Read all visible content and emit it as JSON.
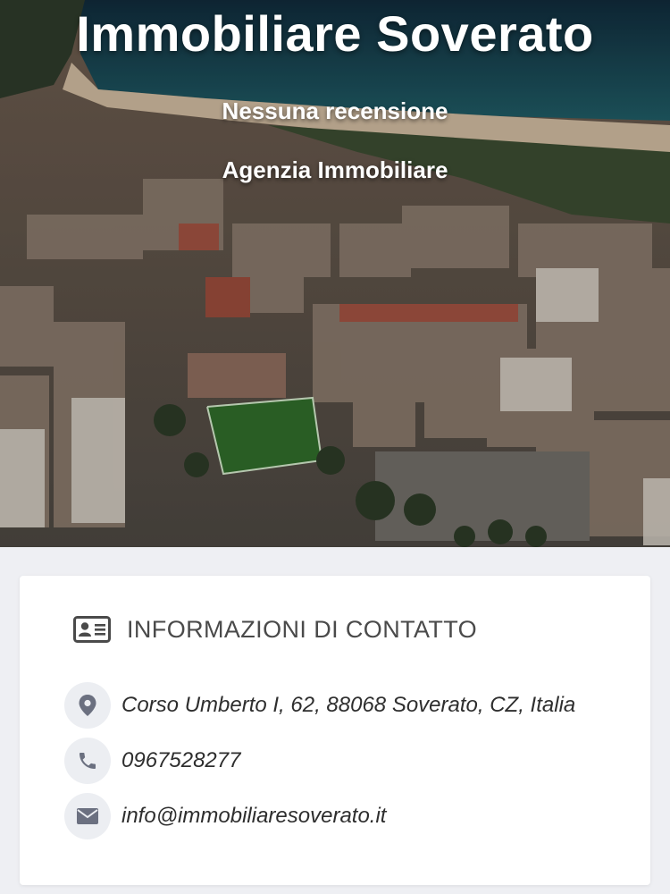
{
  "hero": {
    "title": "Immobiliare Soverato",
    "reviews": "Nessuna recensione",
    "category": "Agenzia Immobiliare"
  },
  "contact": {
    "heading": "INFORMAZIONI DI CONTATTO",
    "address": "Corso Umberto I, 62, 88068 Soverato, CZ, Italia",
    "phone": "0967528277",
    "email": "info@immobiliaresoverato.it"
  },
  "icons": {
    "heading": "id-card-icon",
    "address": "map-marker-icon",
    "phone": "phone-icon",
    "email": "envelope-icon"
  },
  "colors": {
    "icon": "#6b7080",
    "icon_background": "#eceef2",
    "page_background": "#eeeff3",
    "sea": "#1e4d5c"
  }
}
